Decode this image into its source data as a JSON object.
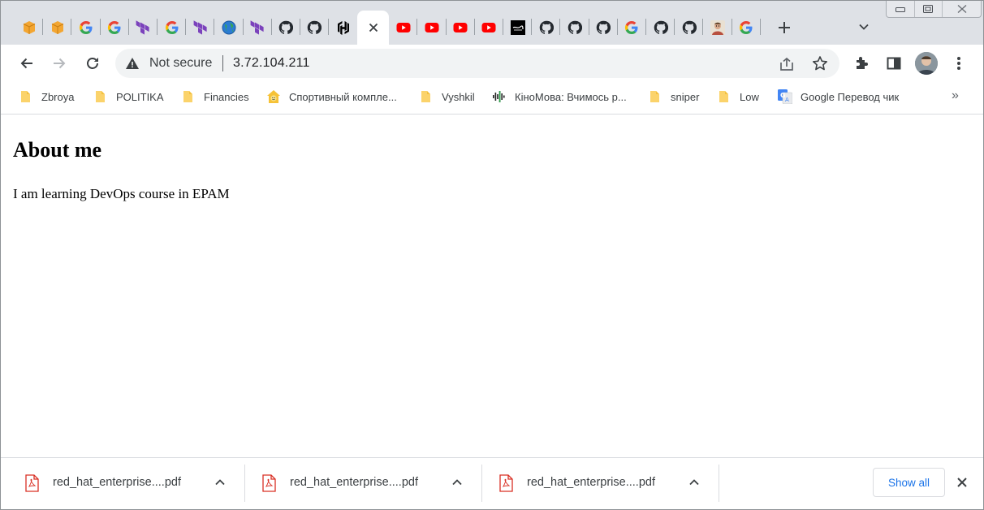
{
  "tabs": [
    {
      "icon": "aws-box-icon",
      "color": "#f3a632"
    },
    {
      "icon": "aws-box-icon",
      "color": "#f3a632"
    },
    {
      "icon": "google-icon"
    },
    {
      "icon": "google-icon"
    },
    {
      "icon": "terraform-icon",
      "color": "#7b42bc"
    },
    {
      "icon": "google-icon"
    },
    {
      "icon": "terraform-icon",
      "color": "#7b42bc"
    },
    {
      "icon": "globe-icon"
    },
    {
      "icon": "terraform-icon",
      "color": "#7b42bc"
    },
    {
      "icon": "github-icon"
    },
    {
      "icon": "github-icon"
    },
    {
      "icon": "hashicorp-icon"
    },
    {
      "icon": "close-icon",
      "active": true
    },
    {
      "icon": "youtube-icon",
      "color": "#ff0000"
    },
    {
      "icon": "youtube-icon",
      "color": "#ff0000"
    },
    {
      "icon": "youtube-icon",
      "color": "#ff0000"
    },
    {
      "icon": "youtube-icon",
      "color": "#ff0000"
    },
    {
      "icon": "black-square-icon"
    },
    {
      "icon": "github-icon"
    },
    {
      "icon": "github-icon"
    },
    {
      "icon": "github-icon"
    },
    {
      "icon": "google-icon"
    },
    {
      "icon": "github-icon"
    },
    {
      "icon": "github-icon"
    },
    {
      "icon": "person-avatar-icon"
    },
    {
      "icon": "google-icon"
    }
  ],
  "omnibox": {
    "security_label": "Not secure",
    "url": "3.72.104.211"
  },
  "bookmarks": [
    {
      "label": "Zbroya",
      "icon": "folder-icon"
    },
    {
      "label": "POLITIKA",
      "icon": "folder-icon"
    },
    {
      "label": "Financies",
      "icon": "folder-icon"
    },
    {
      "label": "Спортивный компле...",
      "icon": "house-smiley-icon"
    },
    {
      "label": "Vyshkil",
      "icon": "folder-icon"
    },
    {
      "label": "КіноМова: Вчимось р...",
      "icon": "soundwave-icon"
    },
    {
      "label": "sniper",
      "icon": "folder-icon"
    },
    {
      "label": "Low",
      "icon": "folder-icon"
    },
    {
      "label": "Google Перевод чик",
      "icon": "google-translate-icon"
    }
  ],
  "bookmarks_more": "»",
  "page": {
    "heading": "About me",
    "paragraph": "I am learning DevOps course in EPAM"
  },
  "downloads": [
    {
      "name": "red_hat_enterprise....pdf"
    },
    {
      "name": "red_hat_enterprise....pdf"
    },
    {
      "name": "red_hat_enterprise....pdf"
    }
  ],
  "show_all_label": "Show all",
  "colors": {
    "tabstrip": "#dee1e6",
    "accent": "#1a73e8",
    "folder": "#fbd36b"
  }
}
